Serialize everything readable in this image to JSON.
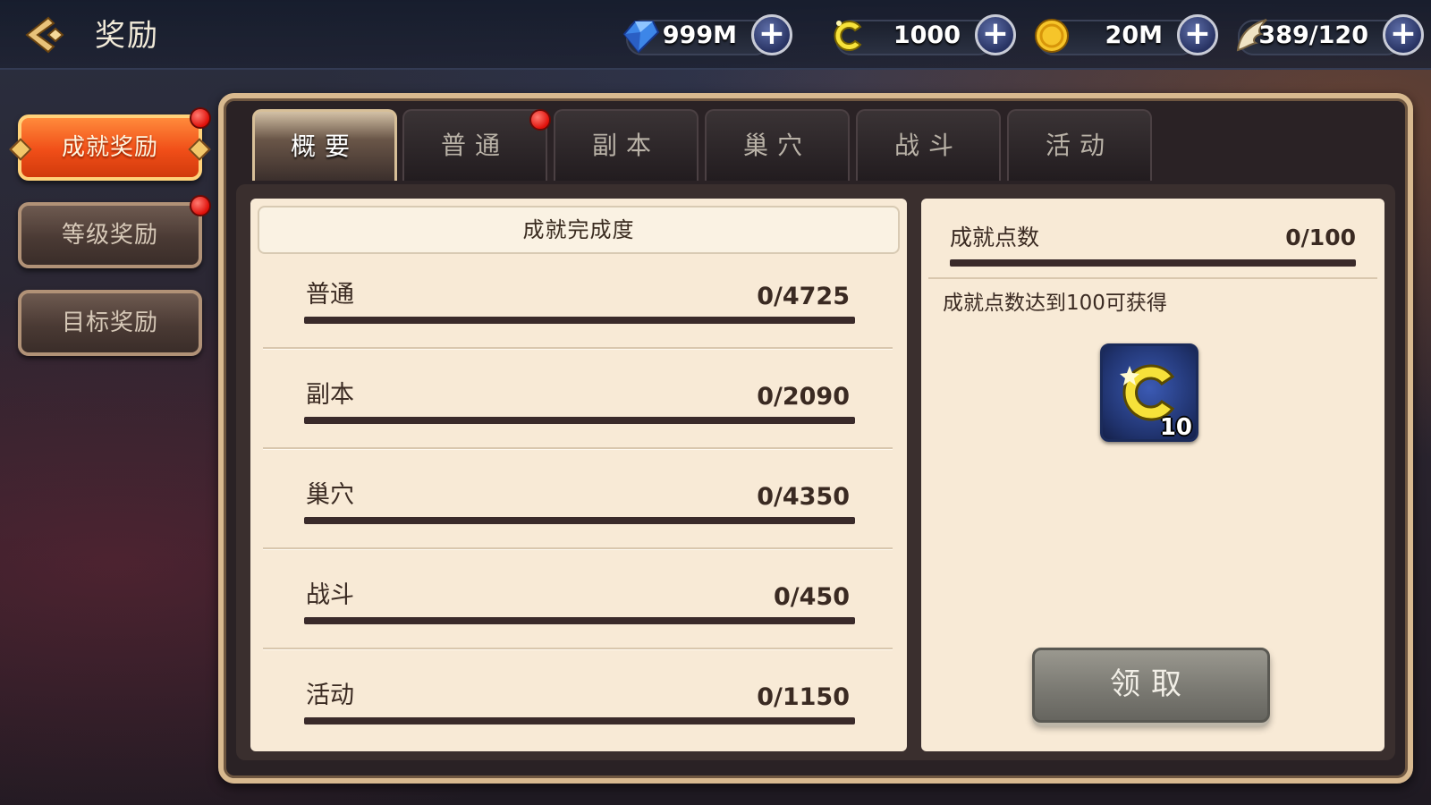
{
  "header": {
    "title": "奖励",
    "back_icon": "back-arrow-icon"
  },
  "resources": [
    {
      "name": "gems",
      "icon": "blue-gem-icon",
      "value": "999M"
    },
    {
      "name": "c-coin",
      "icon": "c-coin-icon",
      "value": "1000"
    },
    {
      "name": "gold",
      "icon": "gold-coin-icon",
      "value": "20M"
    },
    {
      "name": "stamina",
      "icon": "wing-icon",
      "value": "389/120"
    }
  ],
  "sidebar": {
    "items": [
      {
        "label": "成就奖励",
        "active": true,
        "badge": true
      },
      {
        "label": "等级奖励",
        "active": false,
        "badge": true
      },
      {
        "label": "目标奖励",
        "active": false,
        "badge": false
      }
    ]
  },
  "tabs": [
    {
      "label": "概要",
      "active": true,
      "badge": false
    },
    {
      "label": "普通",
      "active": false,
      "badge": true
    },
    {
      "label": "副本",
      "active": false,
      "badge": false
    },
    {
      "label": "巢穴",
      "active": false,
      "badge": false
    },
    {
      "label": "战斗",
      "active": false,
      "badge": false
    },
    {
      "label": "活动",
      "active": false,
      "badge": false
    }
  ],
  "progress": {
    "header": "成就完成度",
    "rows": [
      {
        "label": "普通",
        "count": "0/4725",
        "fraction": 0
      },
      {
        "label": "副本",
        "count": "0/2090",
        "fraction": 0
      },
      {
        "label": "巢穴",
        "count": "0/4350",
        "fraction": 0
      },
      {
        "label": "战斗",
        "count": "0/450",
        "fraction": 0
      },
      {
        "label": "活动",
        "count": "0/1150",
        "fraction": 0
      }
    ]
  },
  "reward": {
    "points_label": "成就点数",
    "points_value": "0/100",
    "points_fraction": 0,
    "description": "成就点数达到100可获得",
    "item_icon": "c-coin-icon",
    "item_quantity": "10",
    "claim_label": "领取"
  },
  "colors": {
    "active_orange": "#f04e18",
    "panel_bg": "#f8ead6",
    "progress_fill": "#ffb03a",
    "badge_red": "#e0100a"
  }
}
